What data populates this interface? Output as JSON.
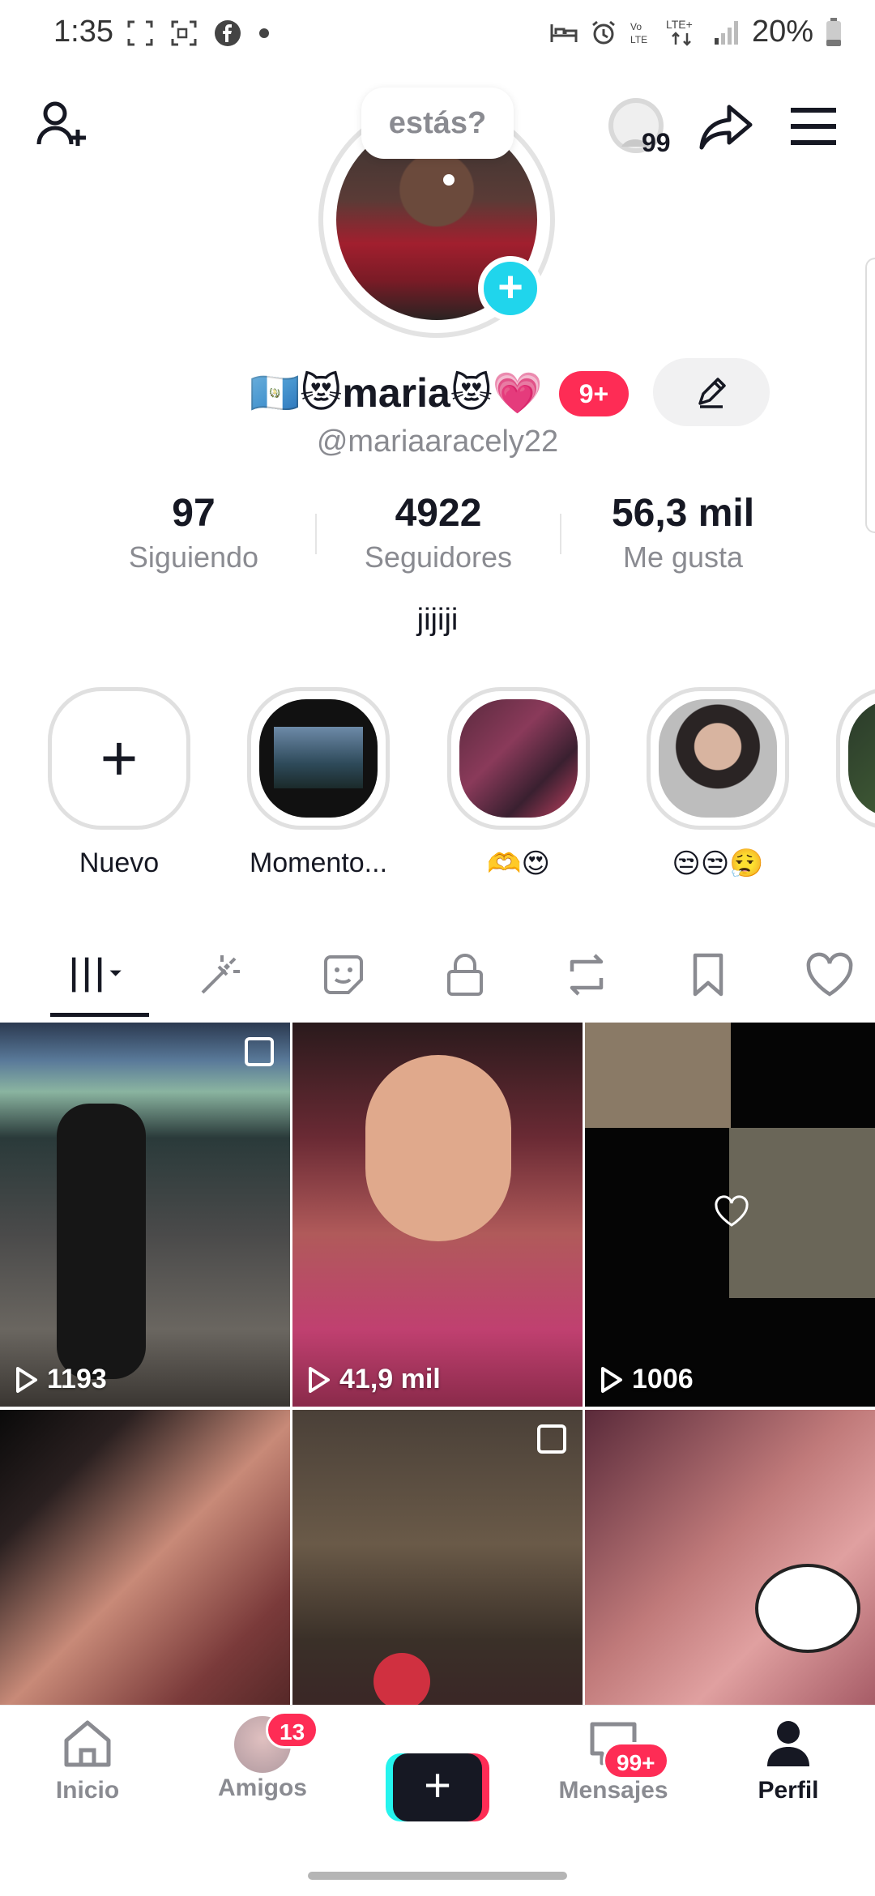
{
  "status_bar": {
    "time": "1:35",
    "battery": "20%",
    "network": "LTE+"
  },
  "header": {
    "note_text": "estás?",
    "notifications_count": "99"
  },
  "profile": {
    "display_name": "🇬🇹😻maria😻💗",
    "badge": "9+",
    "username": "@mariaaracely22",
    "bio": "jijiji",
    "stats": [
      {
        "value": "97",
        "label": "Siguiendo"
      },
      {
        "value": "4922",
        "label": "Seguidores"
      },
      {
        "value": "56,3 mil",
        "label": "Me gusta"
      }
    ]
  },
  "highlights": [
    {
      "label": "Nuevo"
    },
    {
      "label": "Momento..."
    },
    {
      "label": "🫶😍"
    },
    {
      "label": "😒😒😮‍💨"
    }
  ],
  "videos": [
    {
      "views": "1193"
    },
    {
      "views": "41,9 mil"
    },
    {
      "views": "1006"
    },
    {
      "views": ""
    },
    {
      "views": ""
    },
    {
      "views": ""
    }
  ],
  "nav": {
    "home": "Inicio",
    "friends": "Amigos",
    "friends_badge": "13",
    "messages": "Mensajes",
    "messages_badge": "99+",
    "profile": "Perfil"
  },
  "colors": {
    "accent": "#fe2c55",
    "cyan": "#25f4ee",
    "plus_badge": "#20d5ec"
  }
}
